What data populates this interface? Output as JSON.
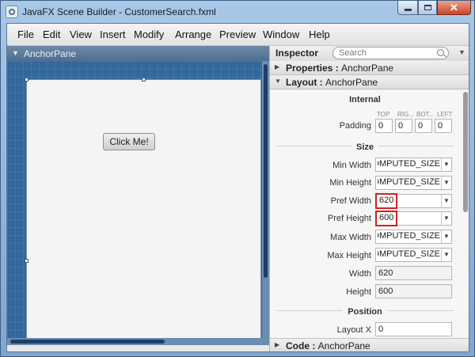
{
  "window": {
    "title": "JavaFX Scene Builder - CustomerSearch.fxml"
  },
  "menubar": {
    "items": [
      "File",
      "Edit",
      "View",
      "Insert",
      "Modify",
      "Arrange",
      "Preview",
      "Window",
      "Help"
    ]
  },
  "canvas": {
    "header_label": "AnchorPane",
    "button_label": "Click Me!"
  },
  "inspector": {
    "title": "Inspector",
    "search_placeholder": "Search",
    "sections": {
      "properties": {
        "label": "Properties",
        "target": "AnchorPane"
      },
      "layout": {
        "label": "Layout",
        "target": "AnchorPane"
      },
      "code": {
        "label": "Code",
        "target": "AnchorPane"
      }
    },
    "groups": {
      "internal": "Internal",
      "size": "Size",
      "position": "Position"
    },
    "padding": {
      "label": "Padding",
      "headers": [
        "TOP",
        "RIG...",
        "BOT...",
        "LEFT"
      ],
      "values": [
        "0",
        "0",
        "0",
        "0"
      ]
    },
    "size_fields": [
      {
        "label": "Min Width",
        "value": "USE_COMPUTED_SIZE",
        "kind": "combo"
      },
      {
        "label": "Min Height",
        "value": "USE_COMPUTED_SIZE",
        "kind": "combo"
      },
      {
        "label": "Pref Width",
        "value": "620",
        "kind": "combo-highlight"
      },
      {
        "label": "Pref Height",
        "value": "600",
        "kind": "combo-highlight"
      },
      {
        "label": "Max Width",
        "value": "USE_COMPUTED_SIZE",
        "kind": "combo"
      },
      {
        "label": "Max Height",
        "value": "USE_COMPUTED_SIZE",
        "kind": "combo"
      },
      {
        "label": "Width",
        "value": "620",
        "kind": "readonly"
      },
      {
        "label": "Height",
        "value": "600",
        "kind": "readonly"
      }
    ],
    "position_fields": [
      {
        "label": "Layout X",
        "value": "0"
      }
    ]
  },
  "colors": {
    "canvas_bg": "#33689c",
    "highlight_border": "#d41f1f",
    "title_bar": "#a9c7e6"
  }
}
